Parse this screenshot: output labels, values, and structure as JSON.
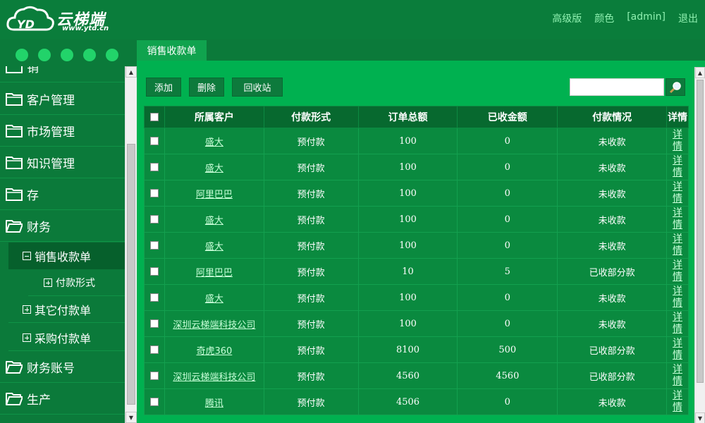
{
  "brand": {
    "name": "云梯端",
    "url": "www.ytd.cn"
  },
  "topnav": {
    "advanced": "高级版",
    "color": "颜色",
    "user": "[admin]",
    "logout": "退出"
  },
  "sidebar": {
    "partial_top": "销",
    "items": [
      "客户管理",
      "市场管理",
      "知识管理",
      "存",
      "财务"
    ],
    "sub_active": "销售收款单",
    "sub_child": "付款形式",
    "sub_others": [
      "其它付款单",
      "采购付款单"
    ],
    "items_bottom": [
      "财务账号",
      "生产"
    ]
  },
  "tab": {
    "label": "销售收款单"
  },
  "toolbar": {
    "add": "添加",
    "delete": "删除",
    "recycle": "回收站"
  },
  "search": {
    "placeholder": ""
  },
  "table": {
    "headers": [
      "所属客户",
      "付款形式",
      "订单总额",
      "已收金额",
      "付款情况",
      "详情"
    ],
    "rows": [
      {
        "customer": "盛大",
        "method": "预付款",
        "total": "100",
        "received": "0",
        "status": "未收款",
        "detail": "详情"
      },
      {
        "customer": "盛大",
        "method": "预付款",
        "total": "100",
        "received": "0",
        "status": "未收款",
        "detail": "详情"
      },
      {
        "customer": "阿里巴巴",
        "method": "预付款",
        "total": "100",
        "received": "0",
        "status": "未收款",
        "detail": "详情"
      },
      {
        "customer": "盛大",
        "method": "预付款",
        "total": "100",
        "received": "0",
        "status": "未收款",
        "detail": "详情"
      },
      {
        "customer": "盛大",
        "method": "预付款",
        "total": "100",
        "received": "0",
        "status": "未收款",
        "detail": "详情"
      },
      {
        "customer": "阿里巴巴",
        "method": "预付款",
        "total": "10",
        "received": "5",
        "status": "已收部分款",
        "detail": "详情"
      },
      {
        "customer": "盛大",
        "method": "预付款",
        "total": "100",
        "received": "0",
        "status": "未收款",
        "detail": "详情"
      },
      {
        "customer": "深圳云梯端科技公司",
        "method": "预付款",
        "total": "100",
        "received": "0",
        "status": "未收款",
        "detail": "详情"
      },
      {
        "customer": "奇虎360",
        "method": "预付款",
        "total": "8100",
        "received": "500",
        "status": "已收部分款",
        "detail": "详情"
      },
      {
        "customer": "深圳云梯端科技公司",
        "method": "预付款",
        "total": "4560",
        "received": "4560",
        "status": "已收部分款",
        "detail": "详情"
      },
      {
        "customer": "腾讯",
        "method": "预付款",
        "total": "4506",
        "received": "0",
        "status": "未收款",
        "detail": "详情"
      }
    ]
  }
}
